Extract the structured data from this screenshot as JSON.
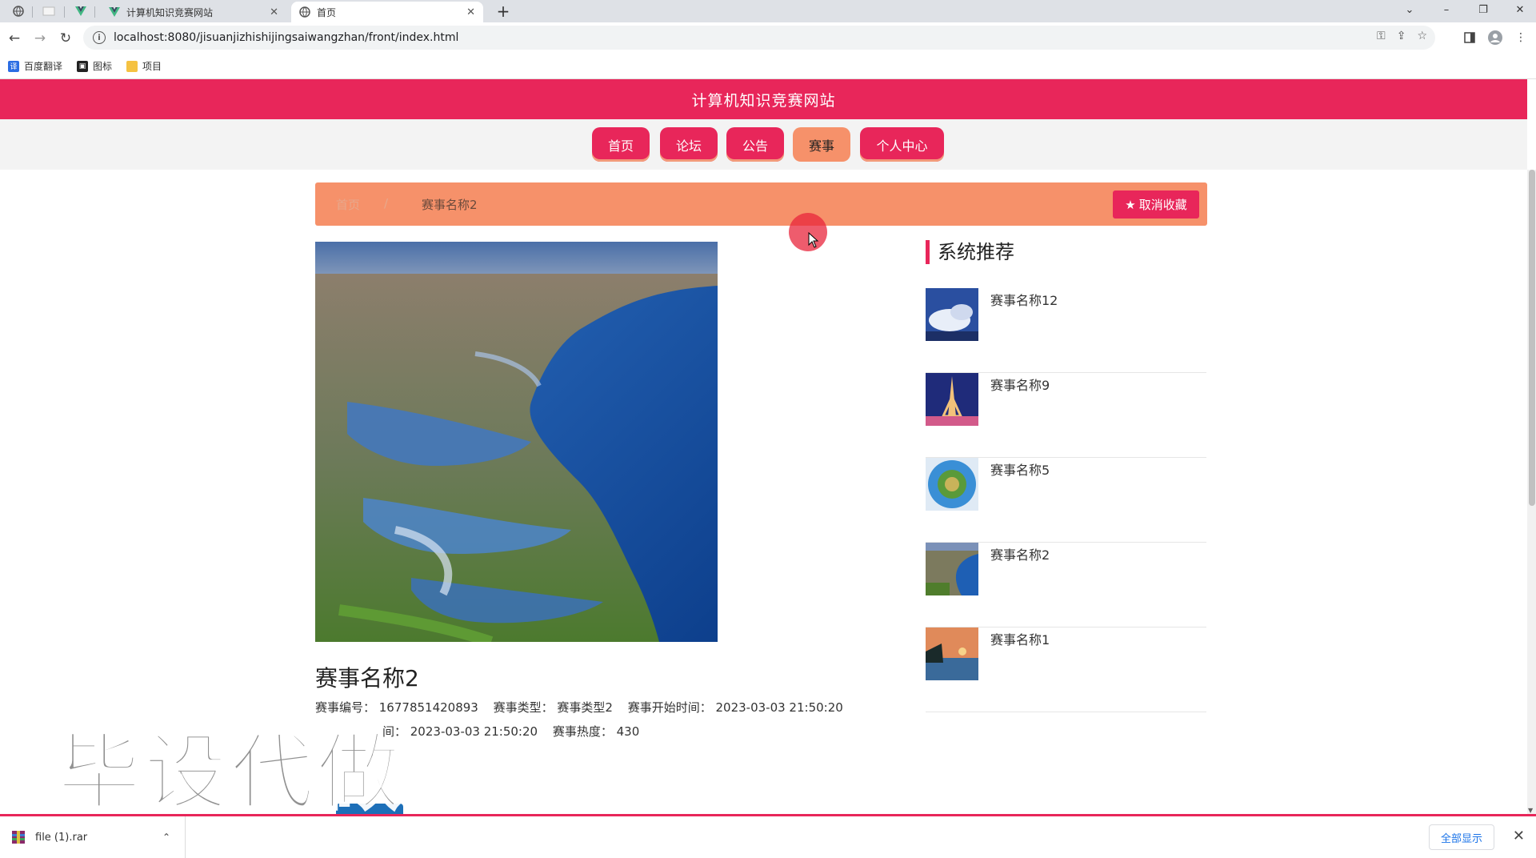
{
  "browser": {
    "tabs": [
      {
        "title": "计算机知识竞赛网站",
        "active": false
      },
      {
        "title": "首页",
        "active": true
      }
    ],
    "url": "localhost:8080/jisuanjizhishijingsaiwangzhan/front/index.html",
    "bookmarks": [
      {
        "label": "百度翻译",
        "icon": "translate-icon"
      },
      {
        "label": "图标",
        "icon": "image-icon"
      },
      {
        "label": "项目",
        "icon": "folder-icon"
      }
    ],
    "new_tab": "+",
    "window_controls": {
      "dropdown": "⌄",
      "minimize": "–",
      "restore": "❐",
      "close": "✕"
    }
  },
  "site": {
    "title": "计算机知识竞赛网站",
    "nav": [
      {
        "label": "首页",
        "active": false
      },
      {
        "label": "论坛",
        "active": false
      },
      {
        "label": "公告",
        "active": false
      },
      {
        "label": "赛事",
        "active": true
      },
      {
        "label": "个人中心",
        "active": false
      }
    ]
  },
  "breadcrumb": {
    "home": "首页",
    "separator": "/",
    "current": "赛事名称2"
  },
  "favorite_button": "取消收藏",
  "detail": {
    "title": "赛事名称2",
    "fields_line1": [
      "赛事编号： 1677851420893",
      "赛事类型： 赛事类型2",
      "赛事开始时间： 2023-03-03 21:50:20"
    ],
    "fields_line2": [
      "间： 2023-03-03 21:50:20",
      "赛事热度： 430"
    ]
  },
  "watermark": "毕设代做",
  "recommend": {
    "title": "系统推荐",
    "items": [
      {
        "name": "赛事名称12",
        "thumb": "clouds"
      },
      {
        "name": "赛事名称9",
        "thumb": "tower"
      },
      {
        "name": "赛事名称5",
        "thumb": "planet"
      },
      {
        "name": "赛事名称2",
        "thumb": "coast"
      },
      {
        "name": "赛事名称1",
        "thumb": "sunset"
      }
    ]
  },
  "downloads": {
    "file": "file (1).rar",
    "show_all": "全部显示",
    "close": "✕"
  },
  "colors": {
    "primary": "#e8265a",
    "accent": "#f6916a"
  }
}
